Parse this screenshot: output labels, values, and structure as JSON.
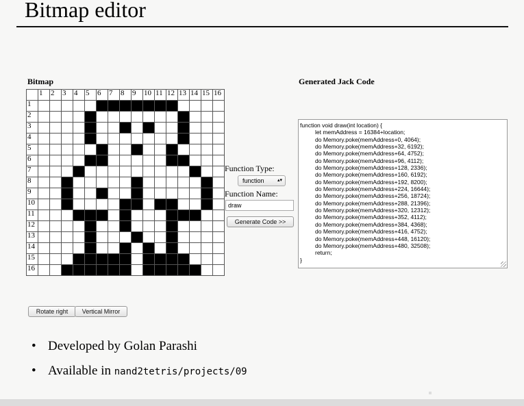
{
  "slide": {
    "title": "Bitmap editor",
    "bullets": [
      {
        "text": "Developed by Golan Parashi",
        "mono": ""
      },
      {
        "text": "Available in ",
        "mono": "nand2tetris/projects/09"
      }
    ]
  },
  "bitmap": {
    "heading": "Bitmap",
    "columns": [
      "1",
      "2",
      "3",
      "4",
      "5",
      "6",
      "7",
      "8",
      "9",
      "10",
      "11",
      "12",
      "13",
      "14",
      "15",
      "16"
    ],
    "rows": [
      "1",
      "2",
      "3",
      "4",
      "5",
      "6",
      "7",
      "8",
      "9",
      "10",
      "11",
      "12",
      "13",
      "14",
      "15",
      "16"
    ],
    "pixels": [
      "0000011111110000",
      "0000100000001000",
      "0000100101001000",
      "0000100000001000",
      "0000010010010000",
      "0000110000011000",
      "0001000000000100",
      "0010000010000010",
      "0010010010000010",
      "0010000110110010",
      "0001110100011100",
      "0000100100010000",
      "0000100010010000",
      "0000100101010000",
      "0001111101111000",
      "0011111101111100"
    ],
    "rotate_label": "Rotate right",
    "mirror_label": "Vertical Mirror"
  },
  "controls": {
    "function_type_label": "Function Type:",
    "function_type_value": "function",
    "function_name_label": "Function Name:",
    "function_name_value": "draw",
    "generate_label": "Generate Code >>"
  },
  "code": {
    "heading": "Generated Jack Code",
    "lines": [
      "function void draw(int location) {",
      "    let memAddress = 16384+location;",
      "    do Memory.poke(memAddress+0, 4064);",
      "    do Memory.poke(memAddress+32, 6192);",
      "    do Memory.poke(memAddress+64, 4752);",
      "    do Memory.poke(memAddress+96, 4112);",
      "    do Memory.poke(memAddress+128, 2336);",
      "    do Memory.poke(memAddress+160, 6192);",
      "    do Memory.poke(memAddress+192, 8200);",
      "    do Memory.poke(memAddress+224, 16644);",
      "    do Memory.poke(memAddress+256, 18724);",
      "    do Memory.poke(memAddress+288, 21396);",
      "    do Memory.poke(memAddress+320, 12312);",
      "    do Memory.poke(memAddress+352, 4112);",
      "    do Memory.poke(memAddress+384, 4368);",
      "    do Memory.poke(memAddress+416, 4752);",
      "    do Memory.poke(memAddress+448, 16120);",
      "    do Memory.poke(memAddress+480, 32508);",
      "    return;",
      "}"
    ]
  }
}
